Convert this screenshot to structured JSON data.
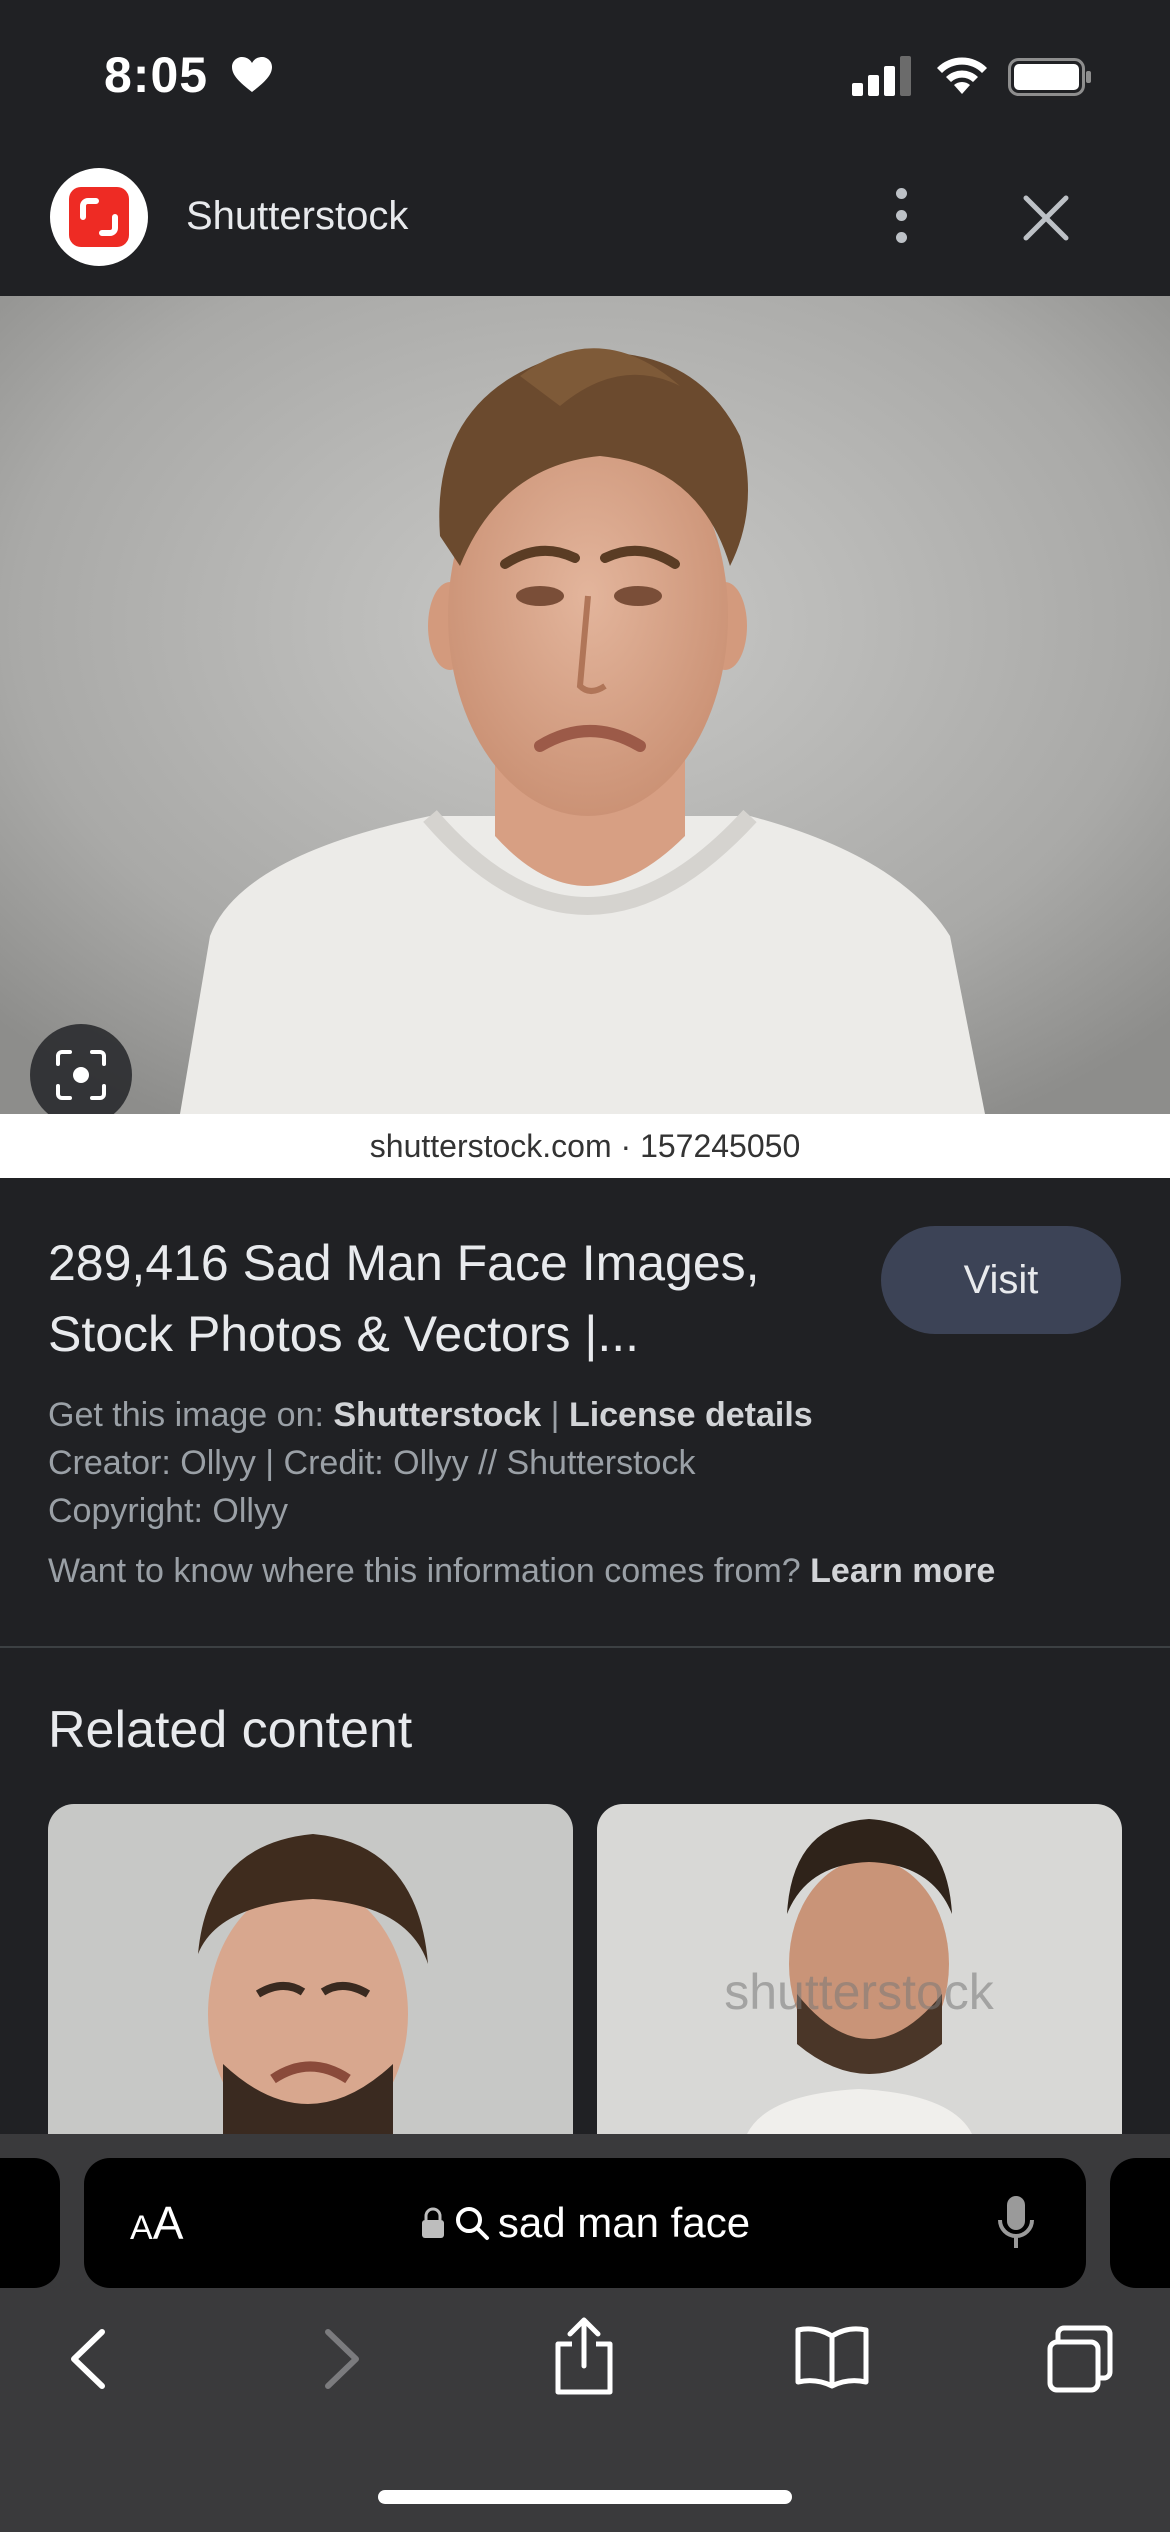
{
  "status_bar": {
    "time": "8:05",
    "icons": [
      "heart-icon",
      "signal-icon",
      "wifi-icon",
      "battery-icon"
    ]
  },
  "header": {
    "site_name": "Shutterstock",
    "logo_color": "#ee2b24",
    "more_icon": "more-vert-icon",
    "close_icon": "close-icon"
  },
  "image": {
    "caption": "shutterstock.com · 157245050",
    "lens_icon": "lens-search-icon"
  },
  "result": {
    "title": "289,416 Sad Man Face Images, Stock Photos & Vectors |...",
    "visit_label": "Visit",
    "get_image_prefix": "Get this image on: ",
    "get_image_source": "Shutterstock",
    "separator": " | ",
    "license_link": "License details",
    "creator_line": "Creator: Ollyy | Credit: Ollyy // Shutterstock",
    "copyright_line": "Copyright: Ollyy",
    "info_question": "Want to know where this information comes from? ",
    "learn_more": "Learn more"
  },
  "related": {
    "title": "Related content",
    "thumb_watermark": "shutterstock"
  },
  "browser": {
    "text_size_small": "A",
    "text_size_big": "A",
    "url_text": "sad man face",
    "lock_icon": "lock-icon",
    "search_icon": "search-icon",
    "mic_icon": "mic-icon",
    "toolbar": [
      "back-icon",
      "forward-icon",
      "share-icon",
      "bookmarks-icon",
      "tabs-icon"
    ]
  },
  "colors": {
    "background": "#202124",
    "visit_button": "#3c4356",
    "toolbar": "#3a3a3c"
  }
}
